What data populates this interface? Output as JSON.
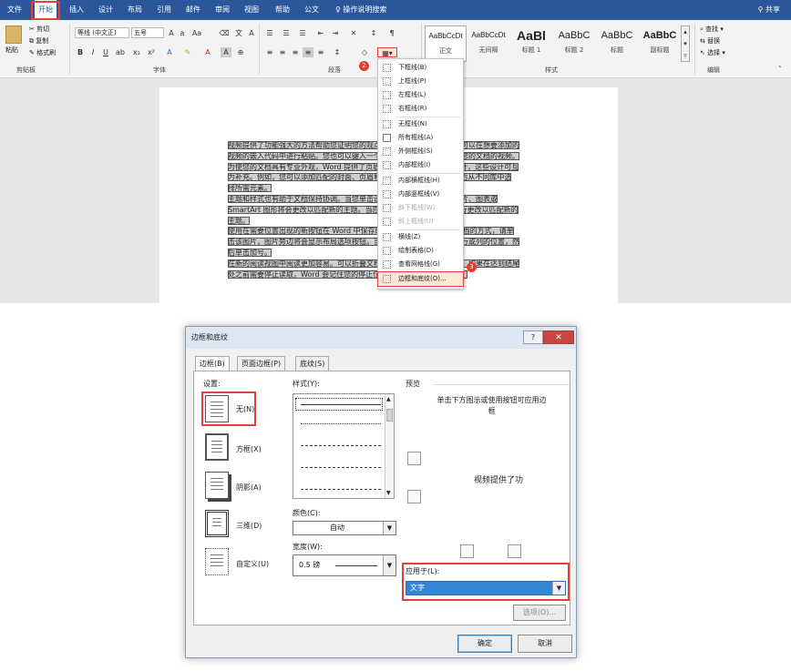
{
  "tabs": [
    "文件",
    "开始",
    "插入",
    "设计",
    "布局",
    "引用",
    "邮件",
    "审阅",
    "视图",
    "帮助",
    "公文"
  ],
  "tab_search": "操作说明搜索",
  "share": "共享",
  "clipboard": {
    "paste": "粘贴",
    "cut": "剪切",
    "copy": "复制",
    "format_painter": "格式刷",
    "label": "剪贴板"
  },
  "font": {
    "name": "等线 (中文正)",
    "size": "五号",
    "label": "字体"
  },
  "paragraph": {
    "label": "段落"
  },
  "styles": {
    "label": "样式",
    "items": [
      {
        "preview": "AaBbCcDt",
        "name": "正文"
      },
      {
        "preview": "AaBbCcDt",
        "name": "无间隔"
      },
      {
        "preview": "AaBl",
        "name": "标题 1"
      },
      {
        "preview": "AaBbC",
        "name": "标题 2"
      },
      {
        "preview": "AaBbC",
        "name": "标题"
      },
      {
        "preview": "AaBbC",
        "name": "副标题"
      }
    ]
  },
  "editing": {
    "find": "查找",
    "replace": "替换",
    "select": "选择",
    "label": "编辑"
  },
  "badges": [
    "1",
    "2",
    "3"
  ],
  "doc_lines": [
    "视频提供了功能强大的方法帮助您证明您的观点。当您单击联机视频时，可以在想要添加的",
    "视频的嵌入代码中进行粘贴。您也可以键入一个关键字以联机搜索最适合您的文档的视频。",
    "为使您的文档具有专业外观，Word 提供了页眉、页脚、封面和文本框设计，这些设计可互",
    "为补充。例如，您可以添加匹配的封面、页眉和提要栏。单击\"插入\"，然后从不同库中选",
    "择所需元素。",
    "主题和样式也有助于文档保持协调。当您单击设计并选择新的主题时，图片、图表或",
    "SmartArt 图形将会更改以匹配新的主题。当应用样式时，您的标题会进行更改以匹配新的",
    "主题。",
    "使用在需要位置出现的新按钮在 Word 中保存时间。若要更改图片适应文档的方式，请单",
    "击该图片，图片旁边将会显示布局选项按钮。当处理表格时，单击要添加行或列的位置，然",
    "后单击加号。",
    "在新的阅读视图中阅读更加容易。可以折叠文档某些部分并关注所需文本。如果在达到结尾",
    "处之前需要停止读取，Word 会记住您的停止位置 - 即使在另一个设备上。"
  ],
  "border_menu": [
    "下框线(B)",
    "上框线(P)",
    "左框线(L)",
    "右框线(R)",
    "无框线(N)",
    "所有框线(A)",
    "外侧框线(S)",
    "内部框线(I)",
    "内部横框线(H)",
    "内部竖框线(V)",
    "斜下框线(W)",
    "斜上框线(U)",
    "横线(Z)",
    "绘制表格(D)",
    "查看网格线(G)",
    "边框和底纹(O)..."
  ],
  "dialog": {
    "title": "边框和底纹",
    "help": "?",
    "close": "✕",
    "tabs": [
      "边框(B)",
      "页面边框(P)",
      "底纹(S)"
    ],
    "setting_label": "设置:",
    "settings": [
      "无(N)",
      "方框(X)",
      "阴影(A)",
      "三维(D)",
      "自定义(U)"
    ],
    "style_label": "样式(Y):",
    "color_label": "颜色(C):",
    "color_value": "自动",
    "width_label": "宽度(W):",
    "width_value": "0.5 磅",
    "preview_label": "预览",
    "preview_hint": "单击下方图示或使用按钮可应用边框",
    "preview_text": "视频提供了功",
    "apply_label": "应用于(L):",
    "apply_value": "文字",
    "options": "选项(O)...",
    "ok": "确定",
    "cancel": "取消"
  }
}
